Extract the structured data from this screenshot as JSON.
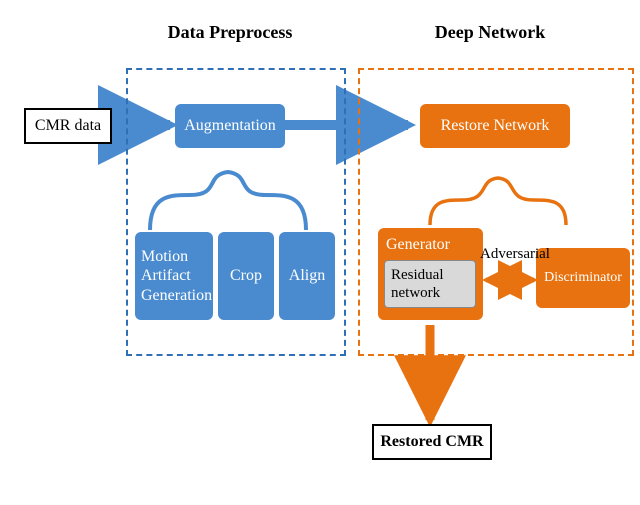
{
  "sections": {
    "preprocess_title": "Data Preprocess",
    "deep_title": "Deep Network"
  },
  "nodes": {
    "input": "CMR data",
    "augmentation": "Augmentation",
    "motion": "Motion\nArtifact\nGeneration",
    "crop": "Crop",
    "align": "Align",
    "restore": "Restore Network",
    "generator": "Generator",
    "residual": "Residual\nnetwork",
    "discriminator": "Discriminator",
    "output": "Restored CMR"
  },
  "edges": {
    "adversarial": "Adversarial"
  }
}
